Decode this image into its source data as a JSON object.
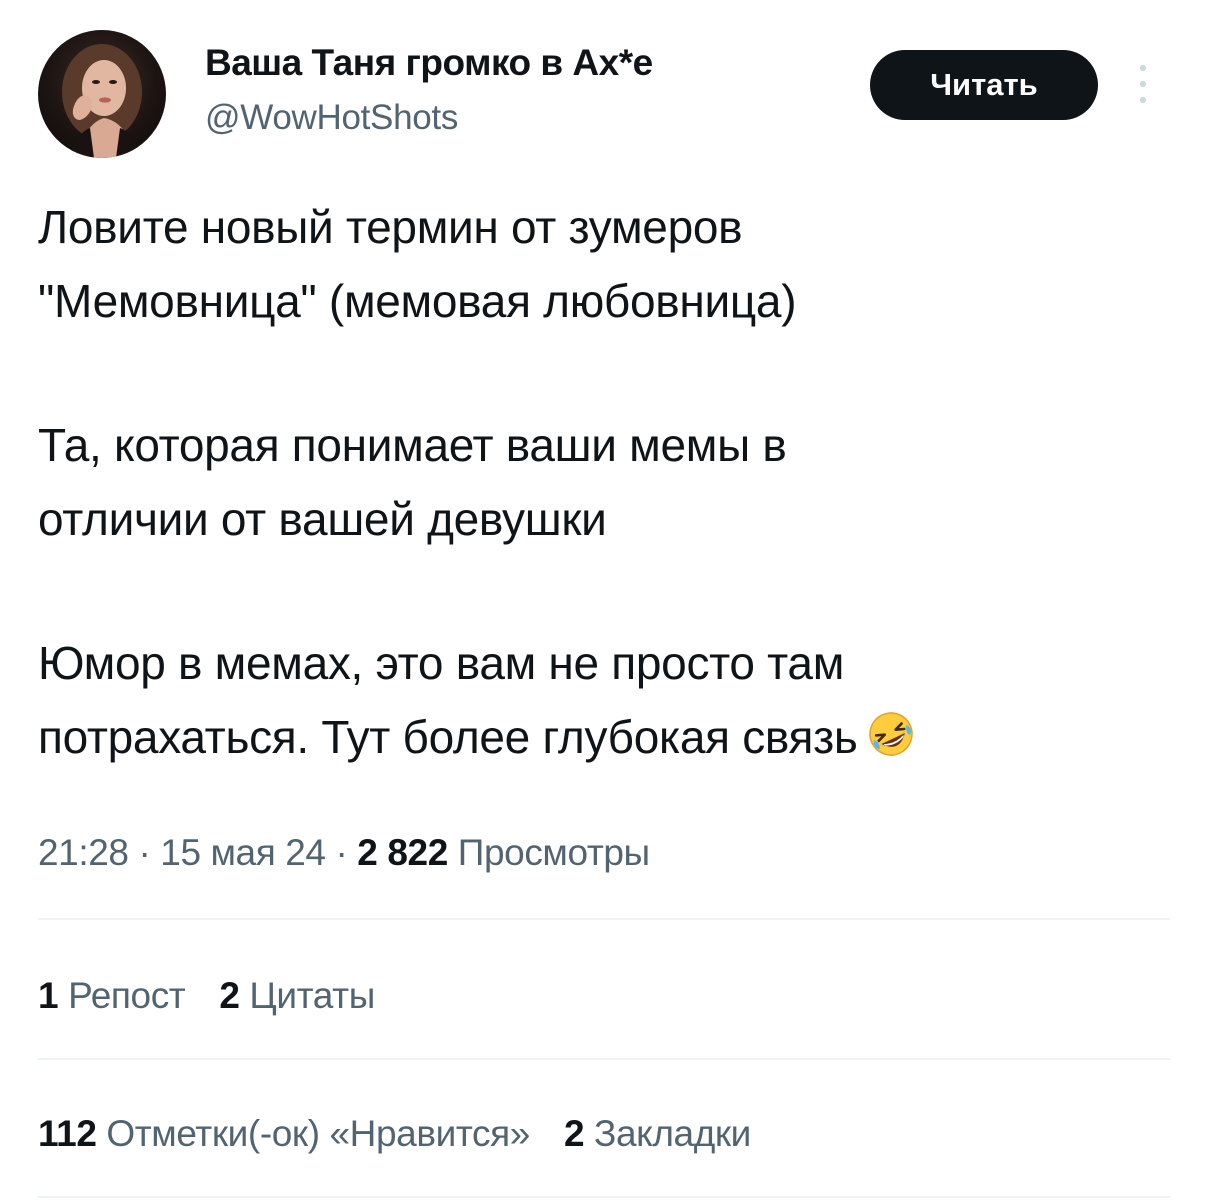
{
  "author": {
    "name": "Ваша Таня громко в Ах*е",
    "handle": "@WowHotShots",
    "avatar_icon": "profile-photo"
  },
  "follow_button": {
    "label": "Читать"
  },
  "more_icon": "vertical-ellipsis-icon",
  "tweet": {
    "lines": [
      "Ловите новый термин от зумеров",
      "\"Мемовница\" (мемовая любовница)",
      "Та, которая понимает ваши мемы в",
      "отличии от вашей девушки",
      "Юмор в мемах, это вам не просто там",
      "потрахаться. Тут более глубокая связь"
    ],
    "emoji": "rolling-on-floor-laughing-emoji"
  },
  "meta": {
    "time": "21:28",
    "sep1": " · ",
    "date": "15 мая 24",
    "sep2": " · ",
    "views_count": "2 822",
    "views_label": " Просмотры"
  },
  "engagement": {
    "reposts_count": "1",
    "reposts_label": " Репост",
    "quotes_count": "2",
    "quotes_label": " Цитаты",
    "likes_count": "112",
    "likes_label": " Отметки(-ок) «Нравится»",
    "bookmarks_count": "2",
    "bookmarks_label": " Закладки"
  },
  "colors": {
    "text": "#0f1419",
    "secondary": "#536471",
    "divider": "#eff3f4",
    "button_bg": "#0f1419",
    "button_text": "#ffffff"
  }
}
